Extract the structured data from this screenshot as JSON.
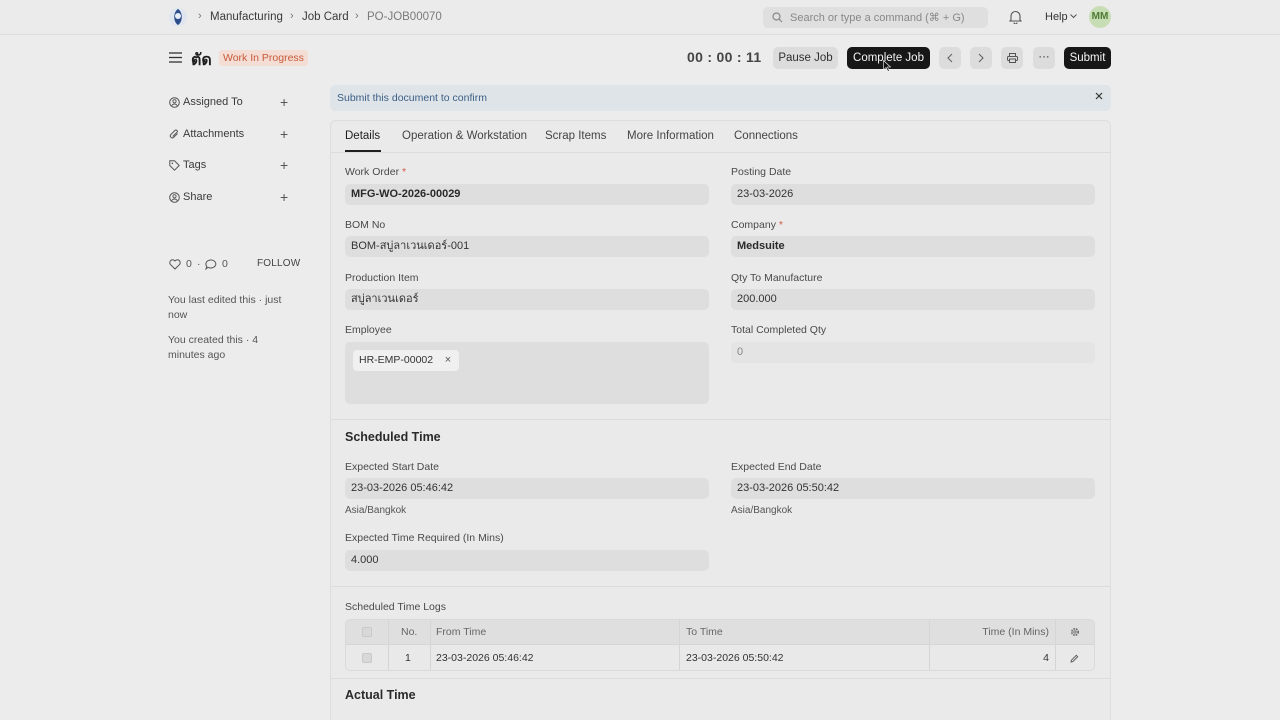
{
  "navbar": {
    "breadcrumbs": [
      "Manufacturing",
      "Job Card",
      "PO-JOB00070"
    ],
    "search_placeholder": "Search or type a command (⌘ + G)",
    "help_label": "Help",
    "avatar_initials": "MM"
  },
  "header": {
    "title": "ตัด",
    "status": "Work In Progress",
    "timer": "00 : 00 : 11",
    "pause_label": "Pause Job",
    "complete_label": "Complete Job",
    "submit_label": "Submit",
    "more_label": "···"
  },
  "sidebar": {
    "items": [
      {
        "label": "Assigned To",
        "icon": "user-add-icon"
      },
      {
        "label": "Attachments",
        "icon": "paperclip-icon"
      },
      {
        "label": "Tags",
        "icon": "tag-icon"
      },
      {
        "label": "Share",
        "icon": "share-user-icon"
      }
    ],
    "likes": "0",
    "comments": "0",
    "follow_label": "FOLLOW",
    "activity": [
      "You last edited this · just now",
      "You created this · 4 minutes ago"
    ]
  },
  "alert": {
    "message": "Submit this document to confirm"
  },
  "tabs": [
    "Details",
    "Operation & Workstation",
    "Scrap Items",
    "More Information",
    "Connections"
  ],
  "details": {
    "work_order": {
      "label": "Work Order",
      "value": "MFG-WO-2026-00029"
    },
    "posting_date": {
      "label": "Posting Date",
      "value": "23-03-2026"
    },
    "bom_no": {
      "label": "BOM No",
      "value": "BOM-สบู่ลาเวนเดอร์-001"
    },
    "company": {
      "label": "Company",
      "value": "Medsuite"
    },
    "production_item": {
      "label": "Production Item",
      "value": "สบู่ลาเวนเดอร์"
    },
    "qty_to_manufacture": {
      "label": "Qty To Manufacture",
      "value": "200.000"
    },
    "employee": {
      "label": "Employee",
      "value": "HR-EMP-00002"
    },
    "total_completed_qty": {
      "label": "Total Completed Qty",
      "value": "0"
    }
  },
  "scheduled_time": {
    "title": "Scheduled Time",
    "expected_start": {
      "label": "Expected Start Date",
      "value": "23-03-2026 05:46:42",
      "tz": "Asia/Bangkok"
    },
    "expected_end": {
      "label": "Expected End Date",
      "value": "23-03-2026 05:50:42",
      "tz": "Asia/Bangkok"
    },
    "expected_time": {
      "label": "Expected Time Required (In Mins)",
      "value": "4.000"
    }
  },
  "time_logs": {
    "label": "Scheduled Time Logs",
    "columns": [
      "No.",
      "From Time",
      "To Time",
      "Time (In Mins)"
    ],
    "rows": [
      {
        "no": "1",
        "from": "23-03-2026 05:46:42",
        "to": "23-03-2026 05:50:42",
        "mins": "4"
      }
    ]
  },
  "actual_time": {
    "title": "Actual Time"
  }
}
